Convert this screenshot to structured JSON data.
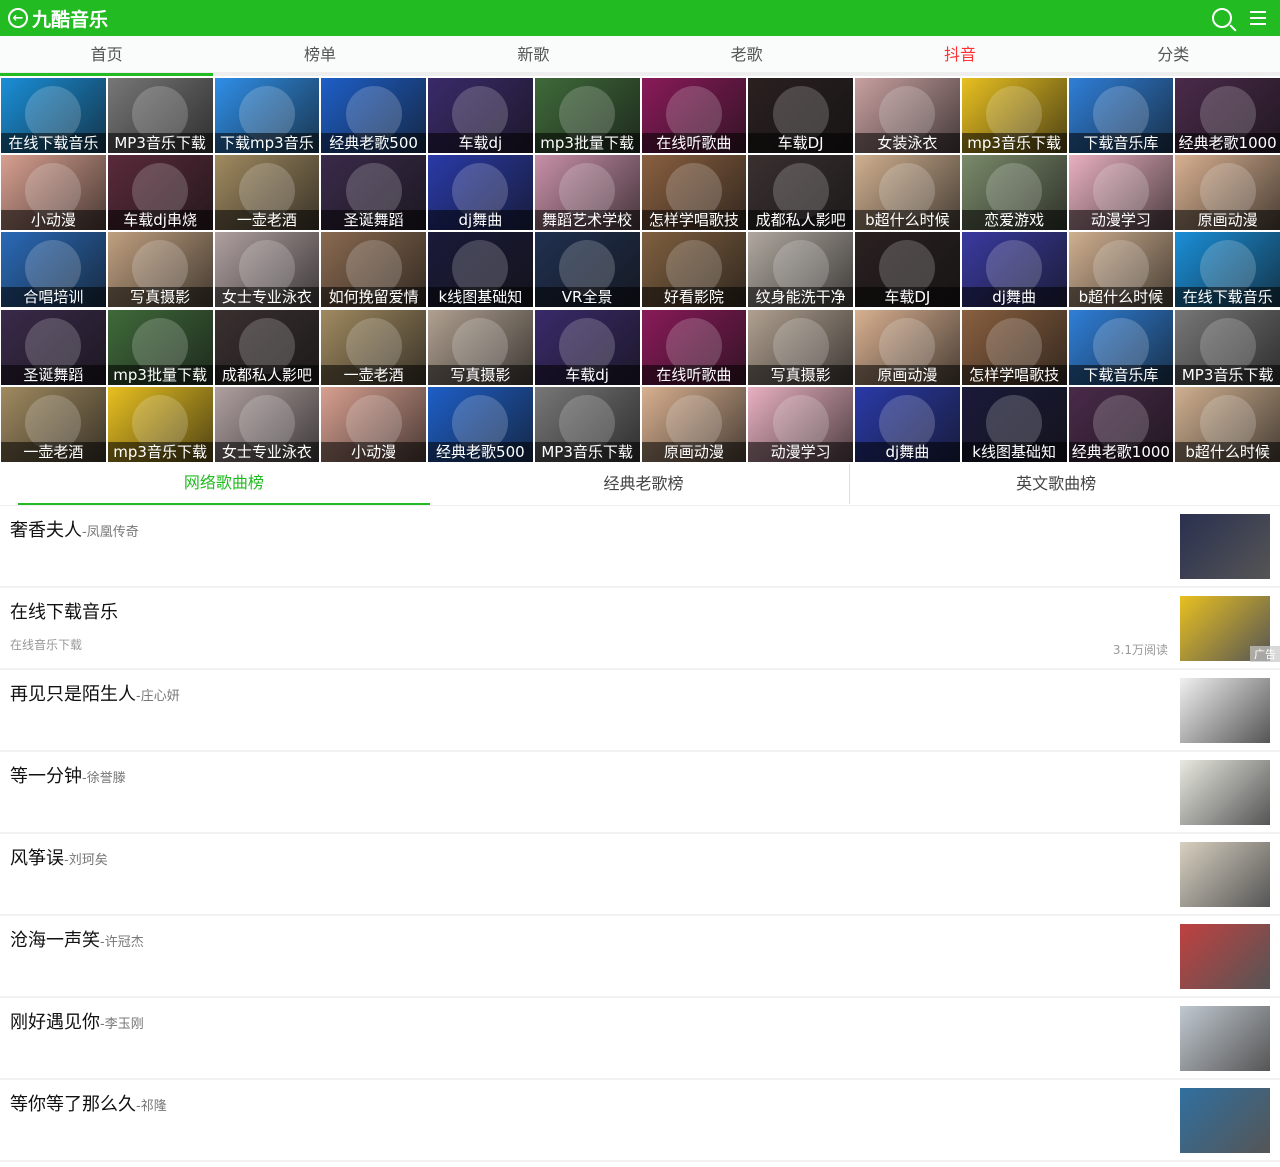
{
  "header": {
    "title": "九酷音乐",
    "accent": "#22bb22"
  },
  "nav": [
    "首页",
    "榜单",
    "新歌",
    "老歌",
    "抖音",
    "分类"
  ],
  "tiles": [
    [
      "在线下载音乐",
      "#1a8fd8"
    ],
    [
      "MP3音乐下载",
      "#777777"
    ],
    [
      "下载mp3音乐",
      "#2f8fe8"
    ],
    [
      "经典老歌500",
      "#1e5fc8"
    ],
    [
      "车载dj",
      "#3a2a6a"
    ],
    [
      "mp3批量下载",
      "#3f6a3a"
    ],
    [
      "在线听歌曲",
      "#8a1a5a"
    ],
    [
      "车载DJ",
      "#2a2020"
    ],
    [
      "女装泳衣",
      "#c8a0a0"
    ],
    [
      "mp3音乐下载",
      "#e8c020"
    ],
    [
      "下载音乐库",
      "#2f7fd8"
    ],
    [
      "经典老歌1000",
      "#4a2a4a"
    ],
    [
      "小动漫",
      "#d8a090"
    ],
    [
      "车载dj串烧",
      "#5a2a3a"
    ],
    [
      "一壶老酒",
      "#a08a60"
    ],
    [
      "圣诞舞蹈",
      "#3a2a4a"
    ],
    [
      "dj舞曲",
      "#2a3aa8"
    ],
    [
      "舞蹈艺术学校",
      "#c890a8"
    ],
    [
      "怎样学唱歌技",
      "#8a6040"
    ],
    [
      "成都私人影吧",
      "#3a3030"
    ],
    [
      "b超什么时候",
      "#d0b090"
    ],
    [
      "恋爱游戏",
      "#7a8a6a"
    ],
    [
      "动漫学习",
      "#e8b0c0"
    ],
    [
      "原画动漫",
      "#d8b090"
    ],
    [
      "合唱培训",
      "#2a6ab8"
    ],
    [
      "写真摄影",
      "#c0a080"
    ],
    [
      "女士专业泳衣",
      "#b0a0a0"
    ],
    [
      "如何挽留爱情",
      "#8a6a50"
    ],
    [
      "k线图基础知",
      "#1a1a3a"
    ],
    [
      "VR全景",
      "#203050"
    ],
    [
      "好看影院",
      "#806040"
    ],
    [
      "纹身能洗干净",
      "#b0a8a0"
    ],
    [
      "车载DJ",
      "#2a2020"
    ],
    [
      "dj舞曲",
      "#3a3aa0"
    ],
    [
      "b超什么时候",
      "#d0b090"
    ],
    [
      "在线下载音乐",
      "#1a8fd8"
    ],
    [
      "圣诞舞蹈",
      "#3a2a4a"
    ],
    [
      "mp3批量下载",
      "#3f6a3a"
    ],
    [
      "成都私人影吧",
      "#3a3030"
    ],
    [
      "一壶老酒",
      "#a08a60"
    ],
    [
      "写真摄影",
      "#b0a090"
    ],
    [
      "车载dj",
      "#3a2a6a"
    ],
    [
      "在线听歌曲",
      "#8a1a5a"
    ],
    [
      "写真摄影",
      "#b0a090"
    ],
    [
      "原画动漫",
      "#d8b090"
    ],
    [
      "怎样学唱歌技",
      "#8a6040"
    ],
    [
      "下载音乐库",
      "#2f7fd8"
    ],
    [
      "MP3音乐下载",
      "#777777"
    ],
    [
      "一壶老酒",
      "#a08a60"
    ],
    [
      "mp3音乐下载",
      "#e8c020"
    ],
    [
      "女士专业泳衣",
      "#b0a0a0"
    ],
    [
      "小动漫",
      "#d8a090"
    ],
    [
      "经典老歌500",
      "#1e5fc8"
    ],
    [
      "MP3音乐下载",
      "#777777"
    ],
    [
      "原画动漫",
      "#d8b090"
    ],
    [
      "动漫学习",
      "#e8b0c0"
    ],
    [
      "dj舞曲",
      "#2a3aa8"
    ],
    [
      "k线图基础知",
      "#1a1a3a"
    ],
    [
      "经典老歌1000",
      "#4a2a4a"
    ],
    [
      "b超什么时候",
      "#d0b090"
    ]
  ],
  "song_tabs": [
    "网络歌曲榜",
    "经典老歌榜",
    "英文歌曲榜"
  ],
  "list": [
    {
      "title": "奢香夫人",
      "artist": "-凤凰传奇",
      "thumb": "#2a3050"
    },
    {
      "title": "在线下载音乐",
      "sub": "在线音乐下载",
      "reads": "3.1万阅读",
      "ad": "广告",
      "thumb": "#e8c020"
    },
    {
      "title": "再见只是陌生人",
      "artist": "-庄心妍",
      "thumb": "#f0f0f0"
    },
    {
      "title": "等一分钟",
      "artist": "-徐誉滕",
      "thumb": "#e8e8e0"
    },
    {
      "title": "风筝误",
      "artist": "-刘珂矣",
      "thumb": "#d8d0c0"
    },
    {
      "title": "沧海一声笑",
      "artist": "-许冠杰",
      "thumb": "#c04040"
    },
    {
      "title": "刚好遇见你",
      "artist": "-李玉刚",
      "thumb": "#c0c8d0"
    },
    {
      "title": "等你等了那么久",
      "artist": "-祁隆",
      "thumb": "#3070a0"
    }
  ]
}
